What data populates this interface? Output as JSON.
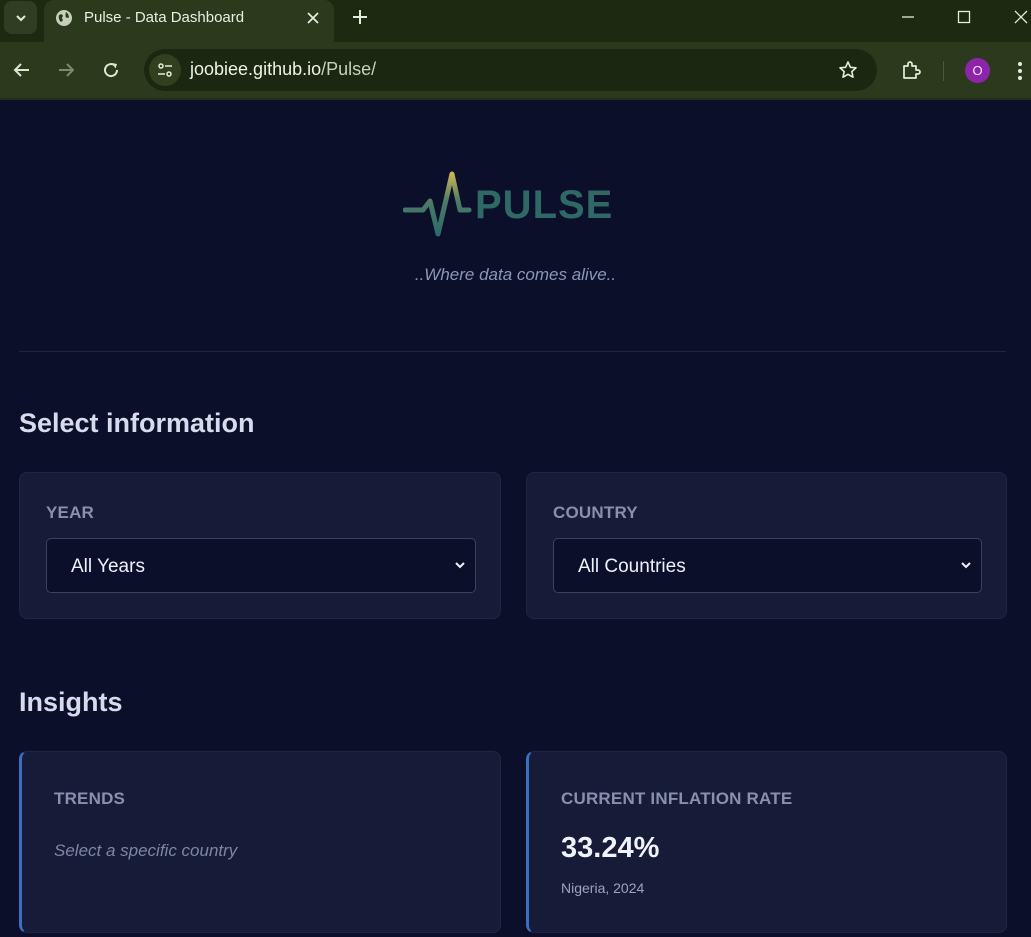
{
  "browser": {
    "tab_title": "Pulse - Data Dashboard",
    "url_host": "joobiee.github.io",
    "url_path": "/Pulse/",
    "avatar_letter": "O"
  },
  "header": {
    "logo_text": "PULSE",
    "tagline": "..Where data comes alive.."
  },
  "select_section": {
    "title": "Select information",
    "year": {
      "label": "YEAR",
      "value": "All Years"
    },
    "country": {
      "label": "COUNTRY",
      "value": "All Countries"
    }
  },
  "insights": {
    "title": "Insights",
    "trends": {
      "label": "TRENDS",
      "placeholder": "Select a specific country"
    },
    "inflation": {
      "label": "CURRENT INFLATION RATE",
      "value": "33.24%",
      "sub": "Nigeria, 2024"
    }
  },
  "colors": {
    "background": "#0b0f2a",
    "card": "#161b38",
    "accent": "#3a6fc4",
    "chrome": "#2b3a1c"
  },
  "icons": [
    "tab-search-icon",
    "globe-icon",
    "close-icon",
    "plus-icon",
    "minimize-icon",
    "maximize-icon",
    "back-icon",
    "forward-icon",
    "reload-icon",
    "site-info-icon",
    "star-icon",
    "extensions-icon",
    "menu-icon",
    "chevron-down-icon"
  ]
}
